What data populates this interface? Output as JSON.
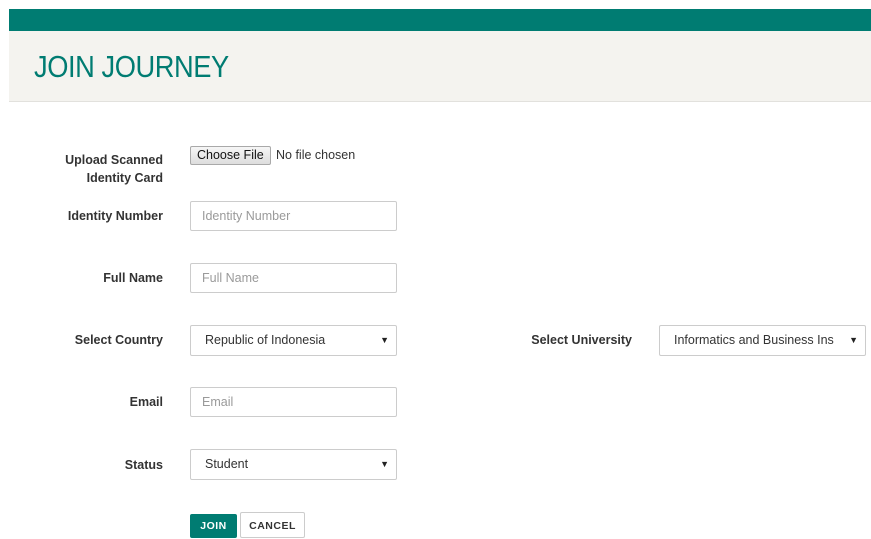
{
  "header": {
    "title": "JOIN JOURNEY"
  },
  "colors": {
    "accent": "#007c72",
    "header_bg": "#f4f3ef"
  },
  "form": {
    "upload": {
      "label_line1": "Upload Scanned",
      "label_line2": "Identity Card",
      "button": "Choose File",
      "status": "No file chosen"
    },
    "identity_number": {
      "label": "Identity Number",
      "placeholder": "Identity Number",
      "value": ""
    },
    "full_name": {
      "label": "Full Name",
      "placeholder": "Full Name",
      "value": ""
    },
    "country": {
      "label": "Select Country",
      "selected": "Republic of Indonesia"
    },
    "university": {
      "label": "Select University",
      "selected": "Informatics and Business Ins"
    },
    "email": {
      "label": "Email",
      "placeholder": "Email",
      "value": ""
    },
    "status": {
      "label": "Status",
      "selected": "Student"
    }
  },
  "actions": {
    "join": "JOIN",
    "cancel": "CANCEL"
  },
  "icons": {
    "dropdown": "triangle-down-icon"
  }
}
